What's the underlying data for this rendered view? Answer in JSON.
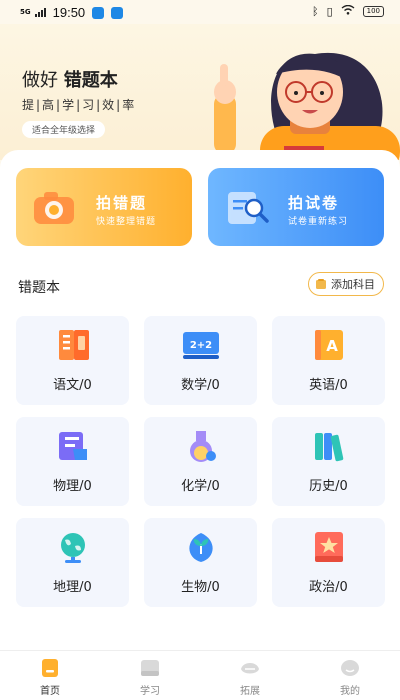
{
  "status_bar": {
    "network": "5G",
    "time": "19:50",
    "battery": "100"
  },
  "header": {
    "title_prefix": "做好",
    "title_bold": "错题本",
    "subtitle": "提|高|学|习|效|率",
    "tag": "适合全年级选择"
  },
  "actions": [
    {
      "title": "拍错题",
      "subtitle": "快速整理错题",
      "icon": "camera-icon"
    },
    {
      "title": "拍试卷",
      "subtitle": "试卷重新练习",
      "icon": "document-search-icon"
    }
  ],
  "section": {
    "title": "错题本",
    "add_label": "添加科目"
  },
  "subjects": [
    {
      "label": "语文/0",
      "icon": "notebook-icon"
    },
    {
      "label": "数学/0",
      "icon": "math-board-icon"
    },
    {
      "label": "英语/0",
      "icon": "letter-a-book-icon"
    },
    {
      "label": "物理/0",
      "icon": "book-stack-icon"
    },
    {
      "label": "化学/0",
      "icon": "flask-icon"
    },
    {
      "label": "历史/0",
      "icon": "books-icon"
    },
    {
      "label": "地理/0",
      "icon": "globe-icon"
    },
    {
      "label": "生物/0",
      "icon": "sprout-icon"
    },
    {
      "label": "政治/0",
      "icon": "star-book-icon"
    }
  ],
  "tabs": [
    {
      "label": "首页",
      "active": true
    },
    {
      "label": "学习",
      "active": false
    },
    {
      "label": "拓展",
      "active": false
    },
    {
      "label": "我的",
      "active": false
    }
  ],
  "colors": {
    "accent_orange": "#ffb02e",
    "accent_blue": "#3d8ef7",
    "header_bg": "#fdf6e3",
    "card_bg": "#f3f6fd"
  }
}
